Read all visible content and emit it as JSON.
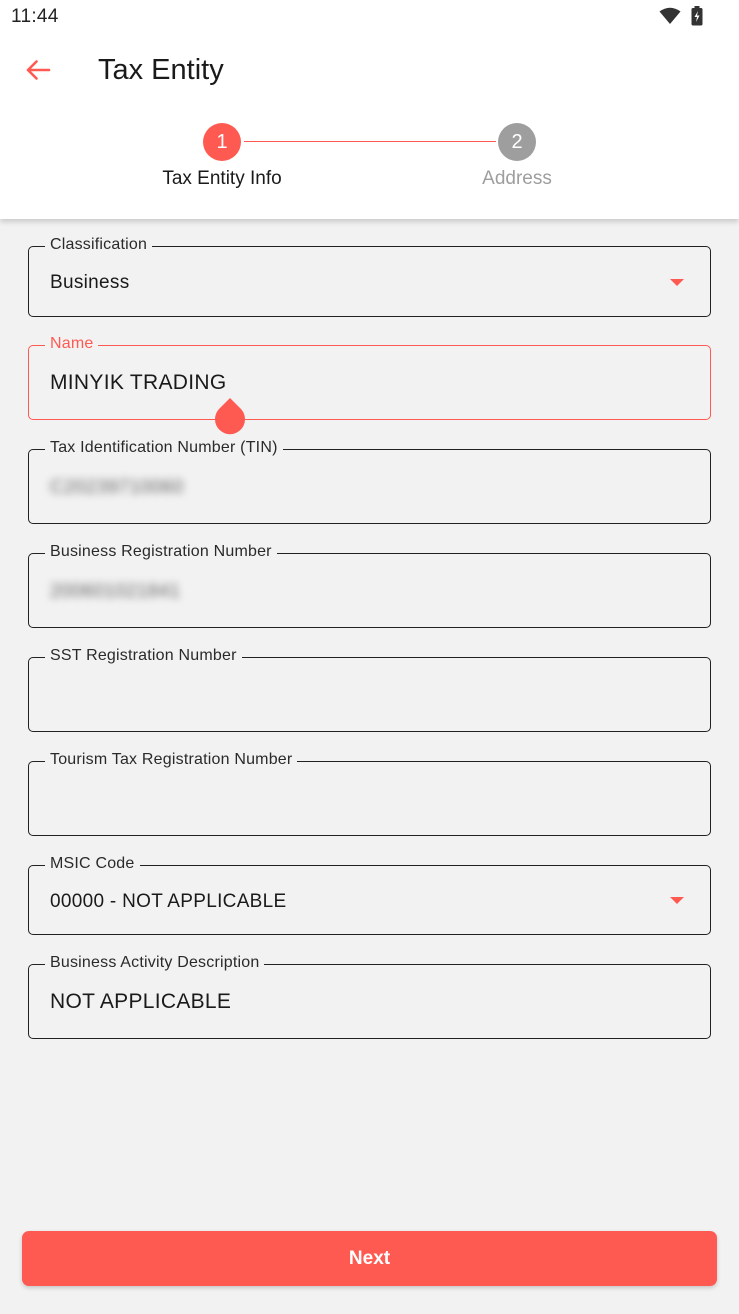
{
  "status_bar": {
    "time": "11:44",
    "icons": [
      "wifi-icon",
      "battery-icon"
    ]
  },
  "app_bar": {
    "title": "Tax Entity",
    "back_icon": "arrow-left-icon"
  },
  "stepper": {
    "steps": [
      {
        "number": "1",
        "label": "Tax Entity Info",
        "state": "active"
      },
      {
        "number": "2",
        "label": "Address",
        "state": "inactive"
      }
    ]
  },
  "form": {
    "classification": {
      "label": "Classification",
      "value": "Business"
    },
    "name": {
      "label": "Name",
      "value": "MINYIK TRADING"
    },
    "tin": {
      "label": "Tax Identification Number (TIN)",
      "value": "C20239710060"
    },
    "brn": {
      "label": "Business Registration Number",
      "value": "200601021841"
    },
    "sst": {
      "label": "SST Registration Number",
      "value": ""
    },
    "tourism": {
      "label": "Tourism Tax Registration Number",
      "value": ""
    },
    "msic": {
      "label": "MSIC Code",
      "value": "00000 - NOT APPLICABLE"
    },
    "activity": {
      "label": "Business Activity Description",
      "value": "NOT APPLICABLE"
    }
  },
  "actions": {
    "next_label": "Next"
  },
  "colors": {
    "accent": "#ff5a52",
    "inactive_step": "#9e9e9e",
    "background": "#f2f2f2",
    "header": "#ffffff"
  }
}
